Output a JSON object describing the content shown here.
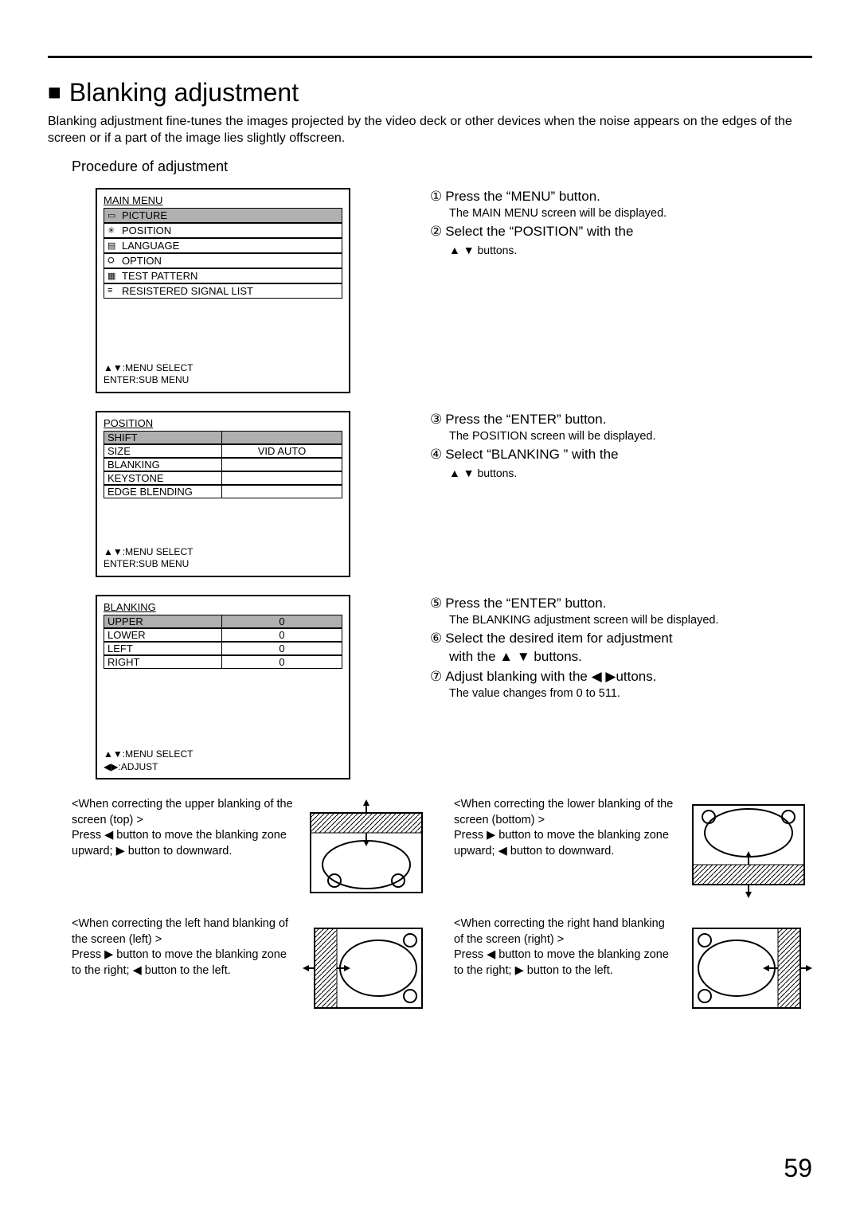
{
  "page_number": "59",
  "section_title": "Blanking adjustment",
  "intro": "Blanking adjustment fine-tunes the images projected by the video deck or other devices when the noise appears on the edges of the screen or if a part of the image lies slightly offscreen.",
  "subheading": "Procedure of adjustment",
  "mainmenu": {
    "title": "MAIN MENU",
    "items": [
      "PICTURE",
      "POSITION",
      "LANGUAGE",
      "OPTION",
      "TEST PATTERN",
      "RESISTERED SIGNAL LIST"
    ],
    "footer1": "▲▼:MENU SELECT",
    "footer2": "ENTER:SUB MENU"
  },
  "posmenu": {
    "title": "POSITION",
    "items": [
      {
        "name": "SHIFT",
        "val": ""
      },
      {
        "name": "SIZE",
        "val": "VID AUTO"
      },
      {
        "name": "BLANKING",
        "val": ""
      },
      {
        "name": "KEYSTONE",
        "val": ""
      },
      {
        "name": "EDGE BLENDING",
        "val": ""
      }
    ],
    "footer1": "▲▼:MENU SELECT",
    "footer2": "ENTER:SUB MENU"
  },
  "blankmenu": {
    "title": "BLANKING",
    "items": [
      {
        "name": "UPPER",
        "val": "0"
      },
      {
        "name": "LOWER",
        "val": "0"
      },
      {
        "name": "LEFT",
        "val": "0"
      },
      {
        "name": "RIGHT",
        "val": "0"
      }
    ],
    "footer1": "▲▼:MENU SELECT",
    "footer2": "◀▶:ADJUST"
  },
  "steps": {
    "s1": "Press the  “MENU” button.",
    "s1sub": "The MAIN MENU screen will be displayed.",
    "s2a": "Select the  “POSITION” with the",
    "s2b": "▲  ▼  buttons.",
    "s3": "Press the  “ENTER” button.",
    "s3sub": "The POSITION screen will be displayed.",
    "s4a": "Select  “BLANKING ” with the",
    "s4b": "▲  ▼  buttons.",
    "s5": "Press the  “ENTER” button.",
    "s5sub": "The BLANKING adjustment screen will be displayed.",
    "s6a": "Select the desired item for adjustment",
    "s6b": "with the   ▲  ▼ buttons.",
    "s7a": "Adjust blanking with the       ◀   ▶uttons.",
    "s7sub": "The value changes from 0 to 511."
  },
  "diag": {
    "upper_title": "<When correcting the upper blanking of the screen (top) >",
    "upper_text": "Press ◀ button to move the blanking zone upward; ▶ button to downward.",
    "lower_title": "<When correcting the lower blanking of the screen (bottom) >",
    "lower_text": "Press ▶ button to move the blanking zone upward; ◀ button to downward.",
    "left_title": "<When correcting the left hand blanking of the screen (left) >",
    "left_text": "Press ▶  button to move the blanking zone to the right; ◀ button to the left.",
    "right_title": "<When correcting the right hand blanking of the screen (right) >",
    "right_text": "Press ◀ button to move the blanking zone to the right; ▶ button to the left."
  }
}
